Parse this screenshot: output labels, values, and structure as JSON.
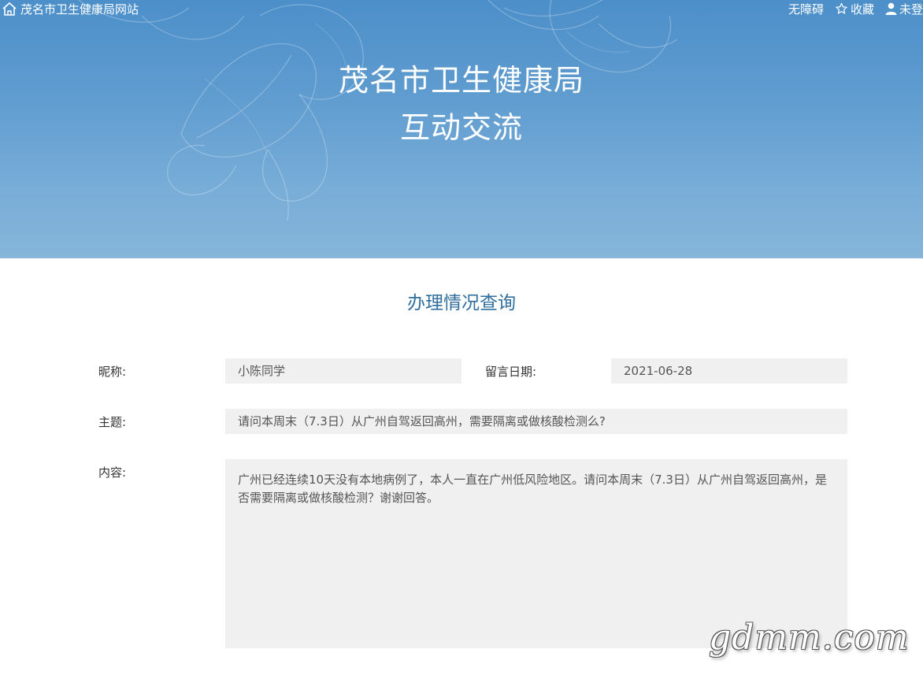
{
  "header": {
    "home_link": "茂名市卫生健康局网站",
    "links": {
      "accessibility": "无障碍",
      "favorite": "收藏",
      "user": "未登"
    }
  },
  "banner": {
    "title_line1": "茂名市卫生健康局",
    "title_line2": "互动交流"
  },
  "section": {
    "title": "办理情况查询"
  },
  "form": {
    "nickname_label": "昵称:",
    "nickname_value": "小陈同学",
    "date_label": "留言日期:",
    "date_value": "2021-06-28",
    "subject_label": "主题:",
    "subject_value": "请问本周末（7.3日）从广州自驾返回高州，需要隔离或做核酸检测么?",
    "content_label": "内容:",
    "content_value": "广州已经连续10天没有本地病例了，本人一直在广州低风险地区。请问本周末（7.3日）从广州自驾返回高州，是否需要隔离或做核酸检测？谢谢回答。"
  },
  "watermark": "gdmm.com",
  "colors": {
    "banner_top": "#4c8fc9",
    "banner_bottom": "#86b5d9",
    "section_title": "#2f6e9e",
    "field_bg": "#f0f0f0"
  }
}
